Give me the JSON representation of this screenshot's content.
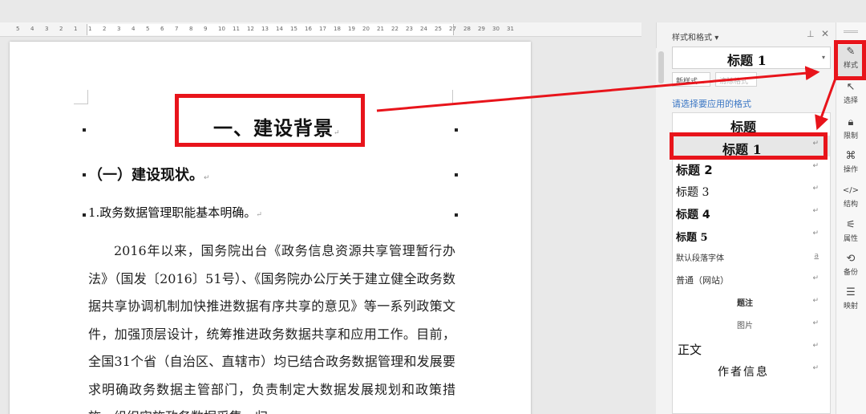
{
  "ruler": {
    "numbers": [
      "5",
      "4",
      "3",
      "2",
      "1",
      "1",
      "2",
      "3",
      "4",
      "5",
      "6",
      "7",
      "8",
      "9",
      "10",
      "11",
      "12",
      "13",
      "14",
      "15",
      "16",
      "17",
      "18",
      "19",
      "20",
      "21",
      "22",
      "23",
      "24",
      "25",
      "27",
      "28",
      "29",
      "30",
      "31"
    ]
  },
  "document": {
    "heading1": "一、建设背景",
    "heading2": "（一）建设现状。",
    "heading3": "1.政务数据管理职能基本明确。",
    "body": "2016年以来，国务院出台《政务信息资源共享管理暂行办法》（国发〔2016〕51号）、《国务院办公厅关于建立健全政务数据共享协调机制加快推进数据有序共享的意见》等一系列政策文件，加强顶层设计，统筹推进政务数据共享和应用工作。目前，全国31个省（自治区、直辖市）均已结合政务数据管理和发展要求明确政务数据主管部门，负责制定大数据发展规划和政策措施，组织实施政务数据采集、归",
    "paragraph_mark": "↵"
  },
  "panel": {
    "title": "样式和格式",
    "title_caret": "▾",
    "pin_icon": "pin-icon",
    "pin_glyph": "⊥",
    "close_glyph": "✕",
    "current_style": "标题 1",
    "dropdown_glyph": "▾",
    "new_style_label": "新样式...",
    "clear_format_label": "清除格式",
    "hint": "请选择要应用的格式",
    "styles": [
      {
        "label": "标题",
        "ret": ""
      },
      {
        "label": "标题 1",
        "ret": "↵"
      },
      {
        "label": "标题 2",
        "ret": "↵"
      },
      {
        "label": "标题 3",
        "ret": "↵"
      },
      {
        "label": "标题 4",
        "ret": "↵"
      },
      {
        "label": "标题 5",
        "ret": "↵"
      },
      {
        "label": "默认段落字体",
        "ret": "a"
      },
      {
        "label": "普通（网站）",
        "ret": "↵"
      },
      {
        "label": "题注",
        "ret": "↵"
      },
      {
        "label": "图片",
        "ret": "↵"
      },
      {
        "label": "正文",
        "ret": "↵"
      },
      {
        "label": "作者信息",
        "ret": "↵"
      }
    ]
  },
  "toolbar": {
    "tools": [
      {
        "label": "样式",
        "icon": "pen-icon",
        "glyph": "✎"
      },
      {
        "label": "选择",
        "icon": "cursor-icon",
        "glyph": "↖"
      },
      {
        "label": "限制",
        "icon": "lock-icon",
        "glyph": "🔒︎"
      },
      {
        "label": "操作",
        "icon": "operation-icon",
        "glyph": "⌘"
      },
      {
        "label": "结构",
        "icon": "code-icon",
        "glyph": "</>"
      },
      {
        "label": "属性",
        "icon": "properties-icon",
        "glyph": "⚟"
      },
      {
        "label": "备份",
        "icon": "backup-icon",
        "glyph": "⟲"
      },
      {
        "label": "映射",
        "icon": "mapping-icon",
        "glyph": "☰"
      }
    ]
  },
  "colors": {
    "annotation": "#e8141b",
    "hint_blue": "#3a76c4"
  }
}
